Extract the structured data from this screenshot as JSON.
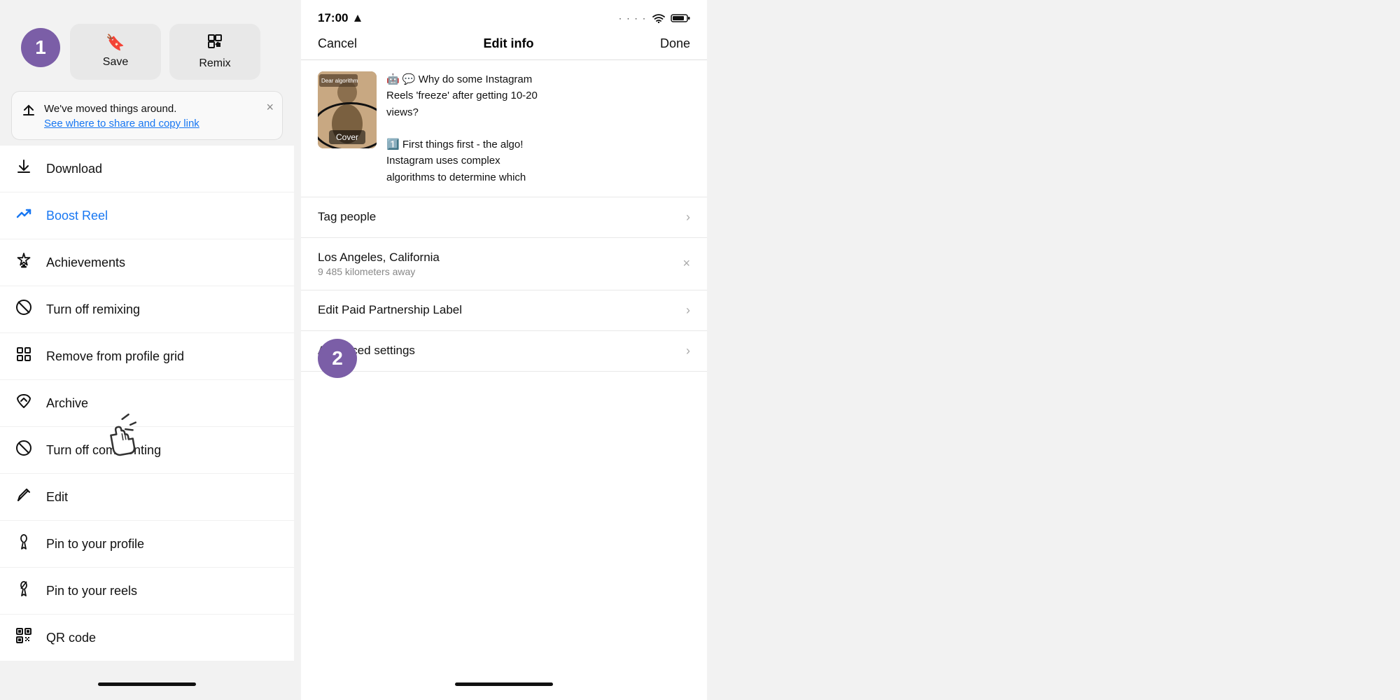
{
  "step1": {
    "badge": "1",
    "color": "#7B5EA7"
  },
  "step2": {
    "badge": "2",
    "color": "#7B5EA7"
  },
  "action_buttons": [
    {
      "id": "save",
      "icon": "🔖",
      "label": "Save"
    },
    {
      "id": "remix",
      "icon": "⬛",
      "label": "Remix"
    }
  ],
  "banner": {
    "text": "We've moved things around.",
    "link": "See where to share and copy link"
  },
  "menu_items": [
    {
      "id": "download",
      "icon": "⬇",
      "label": "Download",
      "highlight": false
    },
    {
      "id": "boost-reel",
      "icon": "📈",
      "label": "Boost Reel",
      "highlight": true
    },
    {
      "id": "achievements",
      "icon": "🏆",
      "label": "Achievements",
      "highlight": false
    },
    {
      "id": "turn-off-remixing",
      "icon": "⊗",
      "label": "Turn off remixing",
      "highlight": false
    },
    {
      "id": "remove-profile-grid",
      "icon": "⊞",
      "label": "Remove from profile grid",
      "highlight": false
    },
    {
      "id": "archive",
      "icon": "↺",
      "label": "Archive",
      "highlight": false
    },
    {
      "id": "turn-off-commenting",
      "icon": "⊘",
      "label": "Turn off commenting",
      "highlight": false
    },
    {
      "id": "edit",
      "icon": "✏",
      "label": "Edit",
      "highlight": false
    },
    {
      "id": "pin-to-profile",
      "icon": "📌",
      "label": "Pin to your profile",
      "highlight": false
    },
    {
      "id": "pin-to-reels",
      "icon": "📌",
      "label": "Pin to your reels",
      "highlight": false
    },
    {
      "id": "qr-code",
      "icon": "⊞",
      "label": "QR code",
      "highlight": false
    }
  ],
  "right_panel": {
    "status_bar": {
      "time": "17:00",
      "location_icon": "▶",
      "dots": "· · · ·",
      "wifi": "wifi",
      "battery": "battery"
    },
    "nav": {
      "cancel": "Cancel",
      "title": "Edit info",
      "done": "Done"
    },
    "preview": {
      "cover_label": "Cover",
      "text_line1": "🤖 💬 Why do some Instagram",
      "text_line2": "Reels 'freeze' after getting 10-20",
      "text_line3": "views?",
      "text_line4": "",
      "text_line5": "1️⃣ First things first - the algo!",
      "text_line6": "Instagram uses complex",
      "text_line7": "algorithms to determine which"
    },
    "settings": [
      {
        "id": "tag-people",
        "label": "Tag people",
        "sub": "",
        "has_chevron": true,
        "has_x": false
      },
      {
        "id": "location",
        "label": "Los Angeles, California",
        "sub": "9 485 kilometers away",
        "has_chevron": false,
        "has_x": true
      },
      {
        "id": "edit-paid-partnership",
        "label": "Edit Paid Partnership Label",
        "sub": "",
        "has_chevron": true,
        "has_x": false
      },
      {
        "id": "advanced-settings",
        "label": "Advanced settings",
        "sub": "",
        "has_chevron": true,
        "has_x": false
      }
    ]
  }
}
